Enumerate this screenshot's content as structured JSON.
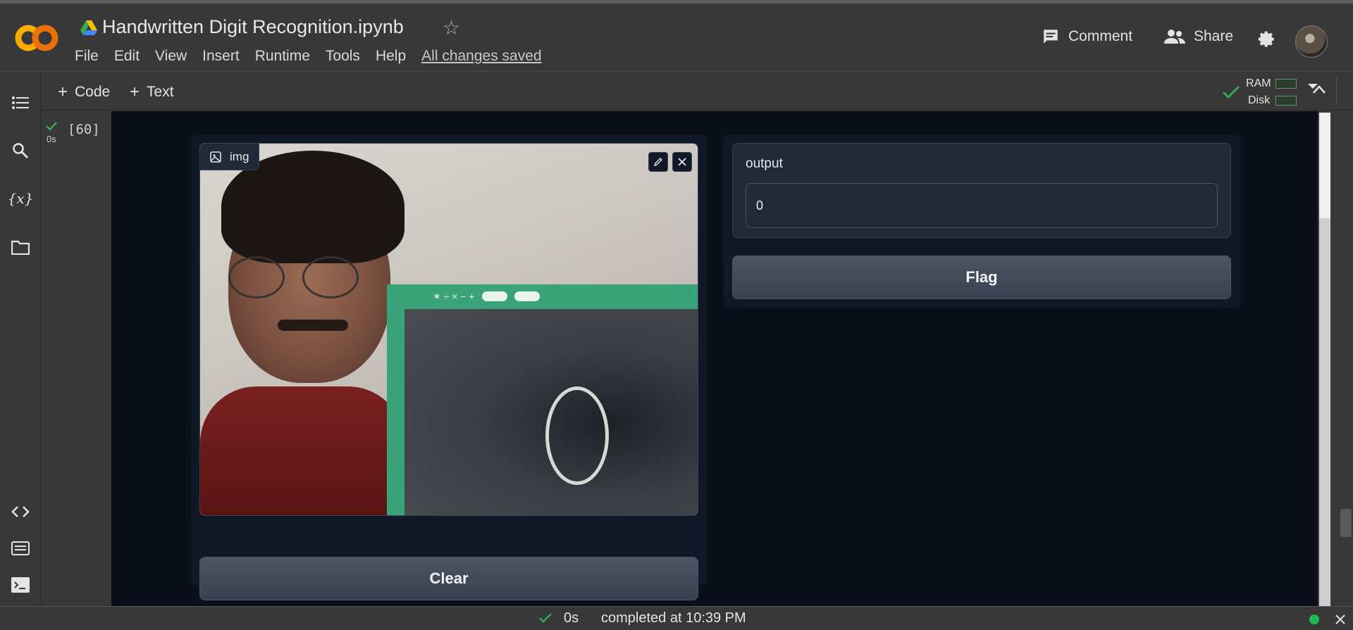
{
  "header": {
    "notebook_title": "Handwritten Digit Recognition.ipynb",
    "logo_text": "CO",
    "menu": [
      "File",
      "Edit",
      "View",
      "Insert",
      "Runtime",
      "Tools",
      "Help"
    ],
    "save_status": "All changes saved",
    "comment_label": "Comment",
    "share_label": "Share"
  },
  "toolbar": {
    "add_code_label": "Code",
    "add_text_label": "Text",
    "ram_label": "RAM",
    "disk_label": "Disk"
  },
  "cell": {
    "execution_count": "[60]",
    "exec_time": "0s"
  },
  "gradio": {
    "image_label": "img",
    "clear_label": "Clear",
    "output_label": "output",
    "output_value": "0",
    "flag_label": "Flag"
  },
  "statusbar": {
    "duration": "0s",
    "message": "completed at 10:39 PM"
  },
  "colors": {
    "colab_orange": "#f9ab00",
    "check_green": "#34a853",
    "status_dot": "#1db954"
  }
}
